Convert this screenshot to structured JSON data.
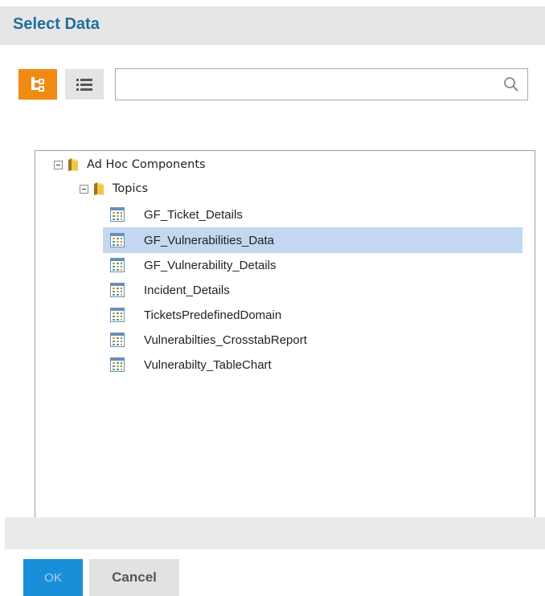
{
  "dialog": {
    "title": "Select Data"
  },
  "toolbar": {
    "tree_view_icon": "tree-view-icon",
    "list_view_icon": "list-view-icon",
    "search_value": "",
    "search_icon": "magnifier-icon"
  },
  "tree": {
    "root": {
      "label": "Ad Hoc Components",
      "expanded": true
    },
    "folder": {
      "label": "Topics",
      "expanded": true
    },
    "items": [
      {
        "label": "GF_Ticket_Details",
        "selected": false
      },
      {
        "label": "GF_Vulnerabilities_Data",
        "selected": true
      },
      {
        "label": "GF_Vulnerability_Details",
        "selected": false
      },
      {
        "label": "Incident_Details",
        "selected": false
      },
      {
        "label": "TicketsPredefinedDomain",
        "selected": false
      },
      {
        "label": "Vulnerabilties_CrosstabReport",
        "selected": false
      },
      {
        "label": "Vulnerabilty_TableChart",
        "selected": false
      }
    ]
  },
  "buttons": {
    "ok": "OK",
    "cancel": "Cancel"
  },
  "colors": {
    "accent_orange": "#f08a13",
    "title_blue": "#1f6f9f",
    "selection": "#c4d7f0",
    "ok_blue": "#1a8fd9"
  }
}
